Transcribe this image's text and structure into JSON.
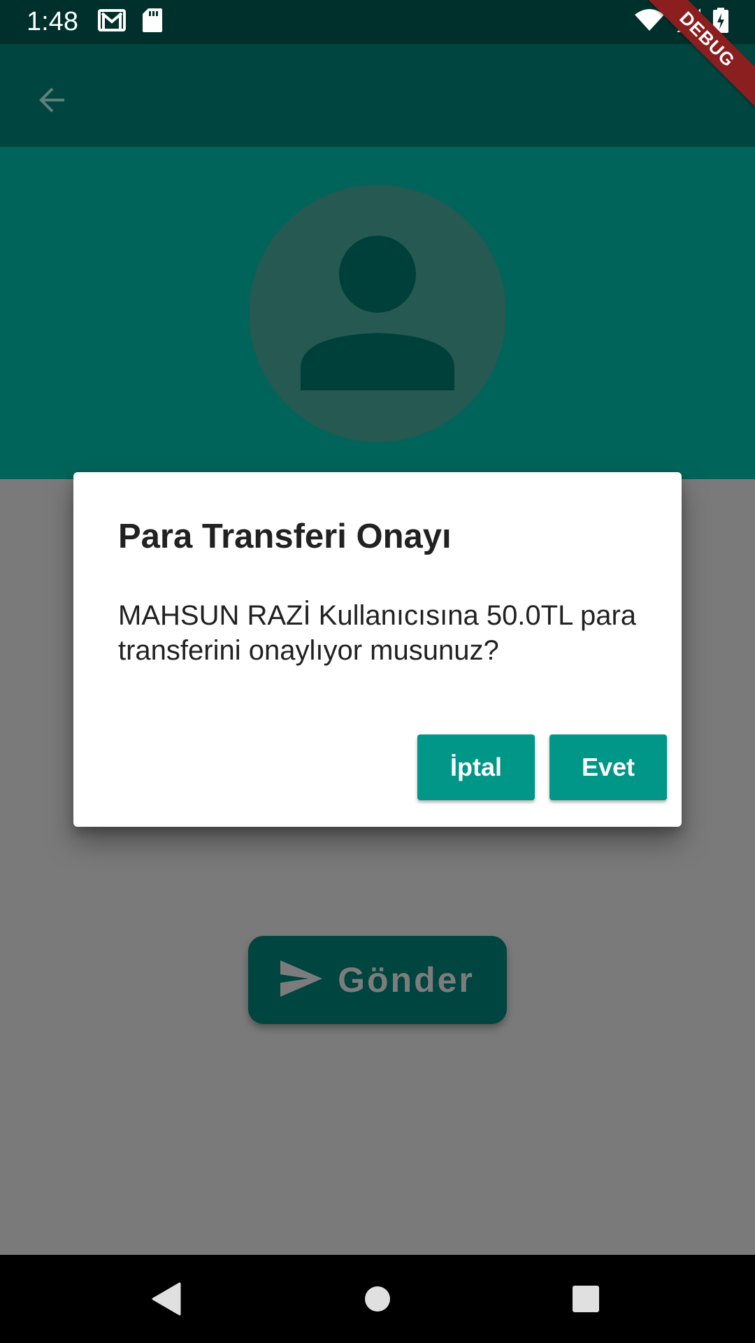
{
  "status_bar": {
    "time": "1:48",
    "left_icons": [
      "gmail-icon",
      "sd-card-icon"
    ],
    "right_icons": [
      "wifi-icon",
      "cell-signal-icon",
      "battery-charging-icon"
    ]
  },
  "debug_banner": "DEBUG",
  "app_bar": {
    "back_icon": "arrow-back-icon"
  },
  "profile": {
    "avatar_icon": "person-icon"
  },
  "send_button": {
    "label": "Gönder",
    "icon": "send-icon"
  },
  "dialog": {
    "title": "Para Transferi Onayı",
    "message": "MAHSUN RAZİ  Kullanıcısına 50.0TL para transferini onaylıyor musunuz?",
    "cancel_label": "İptal",
    "confirm_label": "Evet"
  },
  "nav_bar": {
    "icons": [
      "nav-back-icon",
      "nav-home-icon",
      "nav-recents-icon"
    ]
  },
  "colors": {
    "status_bar": "#00302b",
    "app_bar": "#00453f",
    "header": "#00645a",
    "accent": "#009688",
    "scrim_background": "#7a7a7a"
  }
}
